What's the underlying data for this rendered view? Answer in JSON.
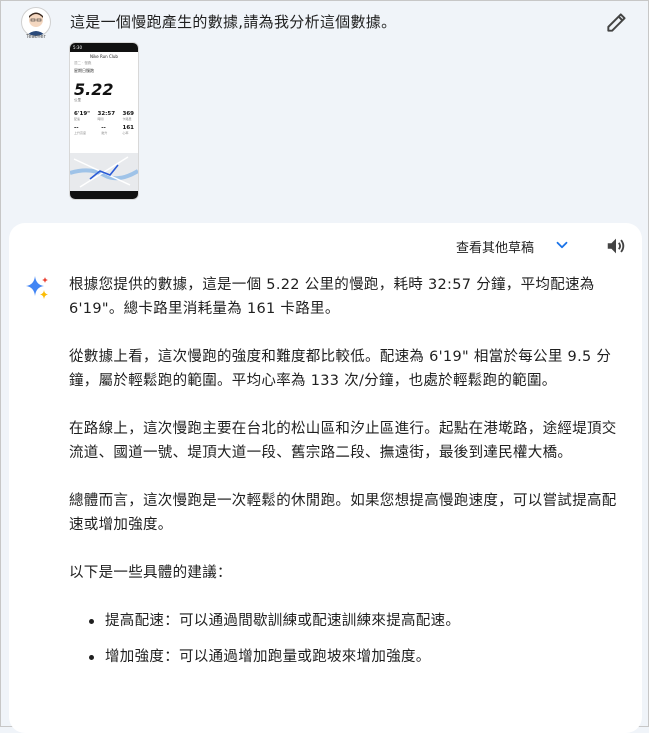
{
  "user": {
    "avatar_caption": "Teacher",
    "prompt": "這是一個慢跑產生的數據,請為我分析這個數據。"
  },
  "thumbnail": {
    "status_time": "5:30",
    "app_name": "Nike Run Club",
    "breadcrumb": "週二 · 慢跑",
    "activity_title": "星期日慢跑",
    "distance": "5.22",
    "distance_unit": "公里",
    "stats": [
      {
        "value": "6'19\"",
        "label": "配速"
      },
      {
        "value": "32:57",
        "label": "時間"
      },
      {
        "value": "369",
        "label": "卡路里"
      }
    ],
    "stats2": [
      {
        "value": "--",
        "label": "上升高度"
      },
      {
        "value": "--",
        "label": "爬升"
      },
      {
        "value": "161",
        "label": "心率"
      }
    ]
  },
  "response": {
    "view_drafts": "查看其他草稿",
    "paragraphs": [
      "根據您提供的數據，這是一個 5.22 公里的慢跑，耗時 32:57 分鐘，平均配速為 6'19\"。總卡路里消耗量為 161 卡路里。",
      "從數據上看，這次慢跑的強度和難度都比較低。配速為 6'19\" 相當於每公里 9.5 分鐘，屬於輕鬆跑的範圍。平均心率為 133 次/分鐘，也處於輕鬆跑的範圍。",
      "在路線上，這次慢跑主要在台北的松山區和汐止區進行。起點在港墘路，途經堤頂交流道、國道一號、堤頂大道一段、舊宗路二段、撫遠街，最後到達民權大橋。",
      "總體而言，這次慢跑是一次輕鬆的休閒跑。如果您想提高慢跑速度，可以嘗試提高配速或增加強度。",
      "以下是一些具體的建議："
    ],
    "suggestions": [
      "提高配速：可以通過間歇訓練或配速訓練來提高配速。",
      "增加強度：可以通過增加跑量或跑坡來增加強度。"
    ]
  }
}
